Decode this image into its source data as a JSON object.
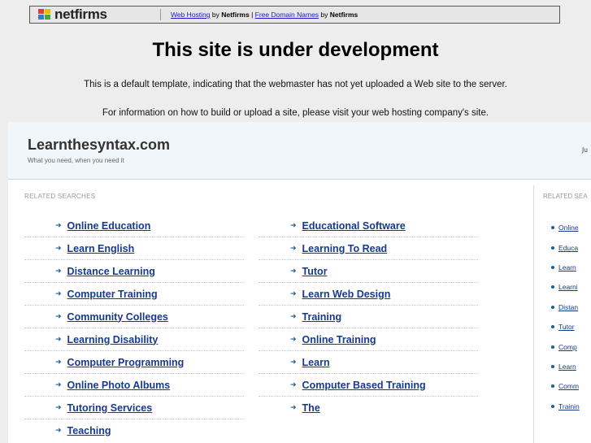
{
  "netfirms_bar": {
    "logo_text": "netfirms",
    "web_hosting_link": "Web Hosting",
    "by1": " by ",
    "brand1": "Netfirms",
    "sep": " | ",
    "domain_link": "Free Domain Names",
    "by2": " by ",
    "brand2": "Netfirms"
  },
  "dev_notice": {
    "title": "This site is under development",
    "line1": "This is a default template, indicating that the webmaster has not yet uploaded a Web site to the server.",
    "line2": "For information on how to build or upload a site, please visit your web hosting company's site."
  },
  "parked_page": {
    "site_name": "Learnthesyntax.com",
    "tagline": "What you need, when you need it",
    "date_partial": "Ju",
    "related_searches_label": "RELATED SEARCHES",
    "side_label": "RELATED SEA",
    "left_items": [
      "Online Education",
      "Learn English",
      "Distance Learning",
      "Computer Training",
      "Community Colleges",
      "Learning Disability",
      "Computer Programming",
      "Online Photo Albums",
      "Tutoring Services",
      "Teaching"
    ],
    "right_items": [
      "Educational Software",
      "Learning To Read",
      "Tutor",
      "Learn Web Design",
      "Training",
      "Online Training",
      "Learn",
      "Computer Based Training",
      "The"
    ],
    "side_items": [
      "Online",
      "Educa",
      "Learn",
      "Learni",
      "Distan",
      "Tutor",
      "Comp",
      "Learn",
      "Comm",
      "Trainin"
    ]
  }
}
